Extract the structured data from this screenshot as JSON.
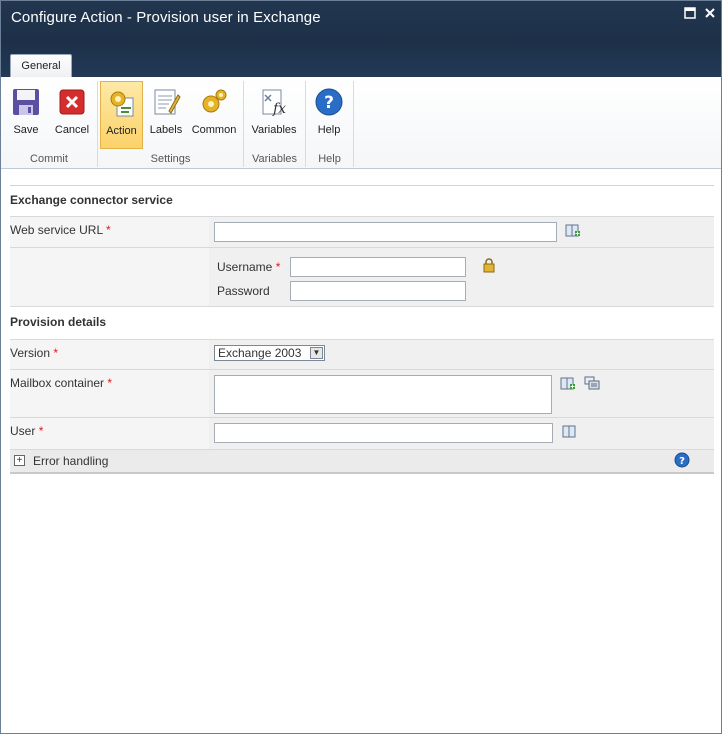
{
  "window": {
    "title": "Configure Action - Provision user in Exchange",
    "maximize_glyph": "▣",
    "close_glyph": "✕"
  },
  "ribbon": {
    "tab_label": "General",
    "buttons": {
      "save": "Save",
      "cancel": "Cancel",
      "action": "Action",
      "labels": "Labels",
      "common": "Common",
      "variables": "Variables",
      "help": "Help"
    },
    "groups": {
      "commit": "Commit",
      "settings": "Settings",
      "variables": "Variables",
      "help": "Help"
    }
  },
  "form": {
    "section1_title": "Exchange connector service",
    "web_service_url_label": "Web service URL",
    "web_service_url_value": "",
    "username_label": "Username",
    "username_value": "",
    "password_label": "Password",
    "password_value": "",
    "section2_title": "Provision details",
    "version_label": "Version",
    "version_selected": "Exchange 2003",
    "mailbox_container_label": "Mailbox container",
    "mailbox_container_value": "",
    "user_label": "User",
    "user_value": "",
    "required_marker": "*",
    "error_handling_label": "Error handling",
    "expand_glyph": "+"
  },
  "colors": {
    "titlebar": "#1f334c",
    "required": "#e0181b",
    "active_button": "#fbd26a"
  },
  "icons": [
    "save-icon",
    "cancel-icon",
    "action-icon",
    "labels-icon",
    "common-icon",
    "variables-icon",
    "help-icon",
    "address-book-icon",
    "lock-icon",
    "ldap-browser-icon"
  ]
}
